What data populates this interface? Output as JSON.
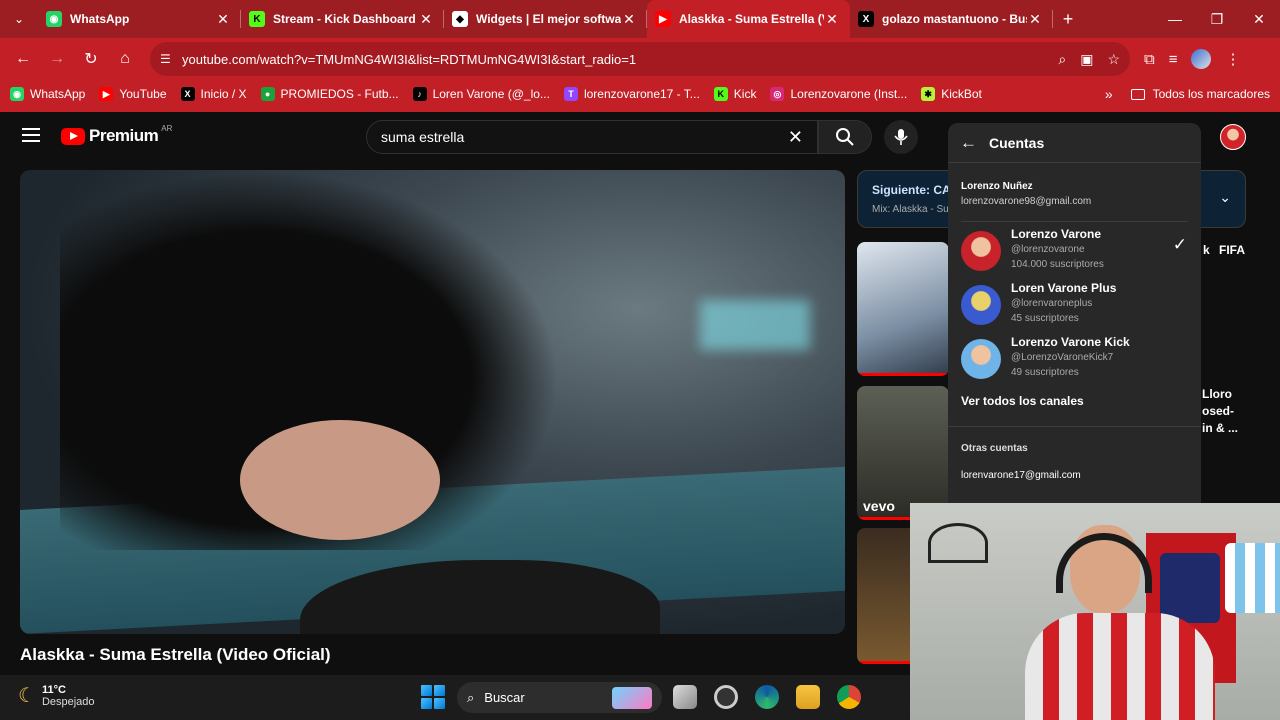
{
  "tabs": [
    {
      "title": "WhatsApp",
      "favicon": "whatsapp-icon",
      "color": "#25d366",
      "glyph": "◉",
      "active": false
    },
    {
      "title": "Stream - Kick Dashboard",
      "favicon": "kick-icon",
      "color": "#53fc18",
      "glyph": "K",
      "active": false
    },
    {
      "title": "Widgets | El mejor software",
      "favicon": "widgets-icon",
      "color": "#ffffff",
      "glyph": "◆",
      "active": false
    },
    {
      "title": "Alaskka - Suma Estrella (Vid",
      "favicon": "youtube-icon",
      "color": "#ff0000",
      "glyph": "▶",
      "active": true
    },
    {
      "title": "golazo mastantuono - Busca",
      "favicon": "x-icon",
      "color": "#000000",
      "glyph": "X",
      "active": false
    }
  ],
  "toolbar": {
    "url": "youtube.com/watch?v=TMUmNG4WI3I&list=RDTMUmNG4WI3I&start_radio=1"
  },
  "bookmarks": [
    {
      "label": "WhatsApp",
      "icon": "whatsapp-icon",
      "color": "#25d366",
      "glyph": "◉"
    },
    {
      "label": "YouTube",
      "icon": "youtube-icon",
      "color": "#ff0000",
      "glyph": "▶"
    },
    {
      "label": "Inicio / X",
      "icon": "x-icon",
      "color": "#000000",
      "glyph": "X"
    },
    {
      "label": "PROMIEDOS - Futb...",
      "icon": "promiedos-icon",
      "color": "#1aa33b",
      "glyph": "●"
    },
    {
      "label": "Loren Varone (@_lo...",
      "icon": "tiktok-icon",
      "color": "#000000",
      "glyph": "♪"
    },
    {
      "label": "lorenzovarone17 - T...",
      "icon": "twitch-icon",
      "color": "#9146ff",
      "glyph": "T"
    },
    {
      "label": "Kick",
      "icon": "kick-icon",
      "color": "#53fc18",
      "glyph": "K"
    },
    {
      "label": "Lorenzovarone (Inst...",
      "icon": "instagram-icon",
      "color": "#d62976",
      "glyph": "◎"
    },
    {
      "label": "KickBot",
      "icon": "kickbot-icon",
      "color": "#b6f23a",
      "glyph": "✱"
    }
  ],
  "bookmarks_folder": "Todos los marcadores",
  "youtube": {
    "logo_text": "Premium",
    "country": "AR",
    "search_query": "suma estrella"
  },
  "video": {
    "title": "Alaskka - Suma Estrella (Video Oficial)"
  },
  "up_next": {
    "title": "Siguiente: CAN",
    "subtitle": "Mix: Alaskka - Su"
  },
  "side_texts": {
    "t1a": "k",
    "t1b": "FIFA",
    "t2a": "Lloro",
    "t2b": "osed-",
    "t2c": "in & ...",
    "vevo": "vevo"
  },
  "accounts": {
    "title": "Cuentas",
    "owner_name": "Lorenzo Nuñez",
    "owner_email": "lorenzovarone98@gmail.com",
    "channels": [
      {
        "name": "Lorenzo Varone",
        "handle": "@lorenzovarone",
        "subs": "104.000 suscriptores",
        "selected": true
      },
      {
        "name": "Loren Varone Plus",
        "handle": "@lorenvaroneplus",
        "subs": "45 suscriptores",
        "selected": false
      },
      {
        "name": "Lorenzo Varone Kick",
        "handle": "@LorenzoVaroneKick7",
        "subs": "49 suscriptores",
        "selected": false
      }
    ],
    "see_all": "Ver todos los canales",
    "others_label": "Otras cuentas",
    "other_email": "lorenvarone17@gmail.com"
  },
  "taskbar": {
    "temp": "11°C",
    "weather": "Despejado",
    "search_placeholder": "Buscar"
  },
  "colors": {
    "chrome_red": "#c21f26",
    "youtube_red": "#ff0000",
    "background": "#0f0f0f"
  }
}
